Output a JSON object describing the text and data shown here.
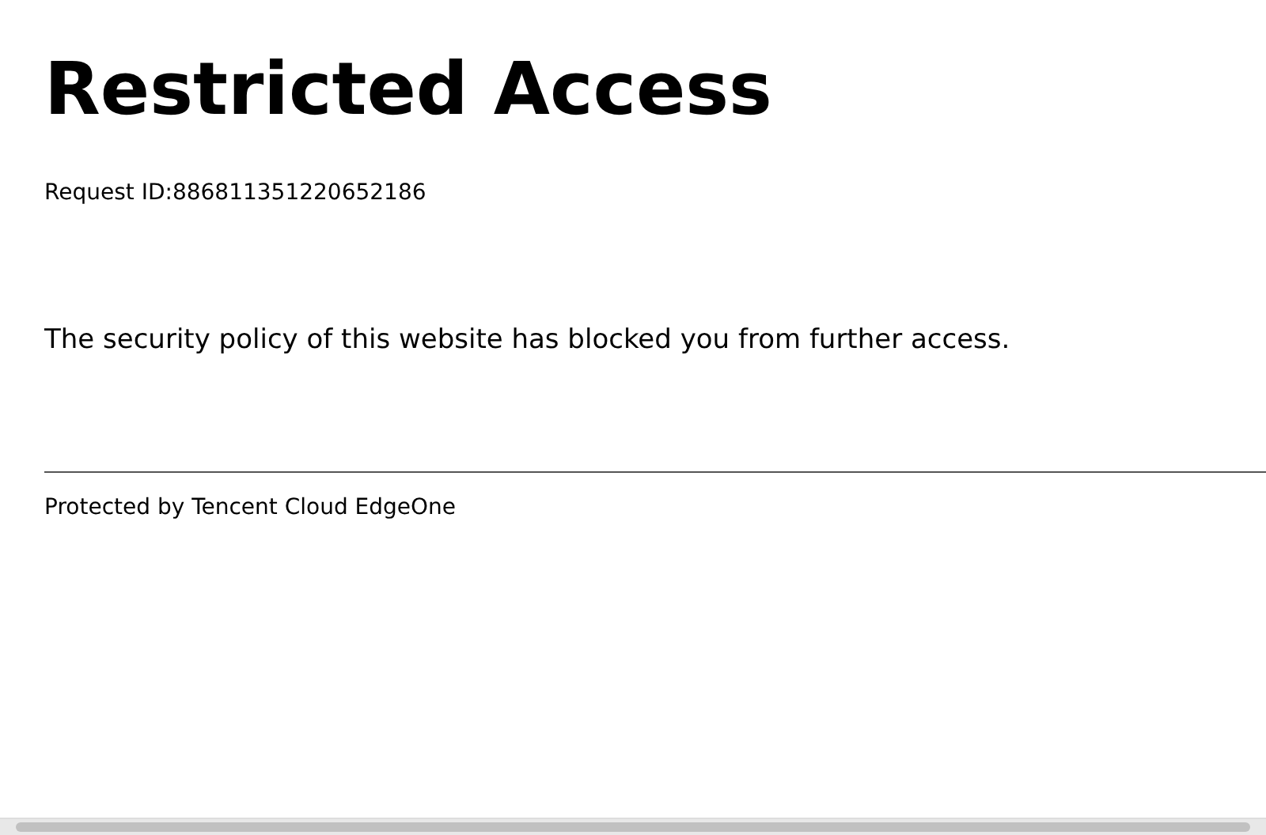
{
  "heading": "Restricted Access",
  "request_id": "Request ID:886811351220652186",
  "message": "The security policy of this website has blocked you from further access.",
  "footer": "Protected by Tencent Cloud EdgeOne"
}
